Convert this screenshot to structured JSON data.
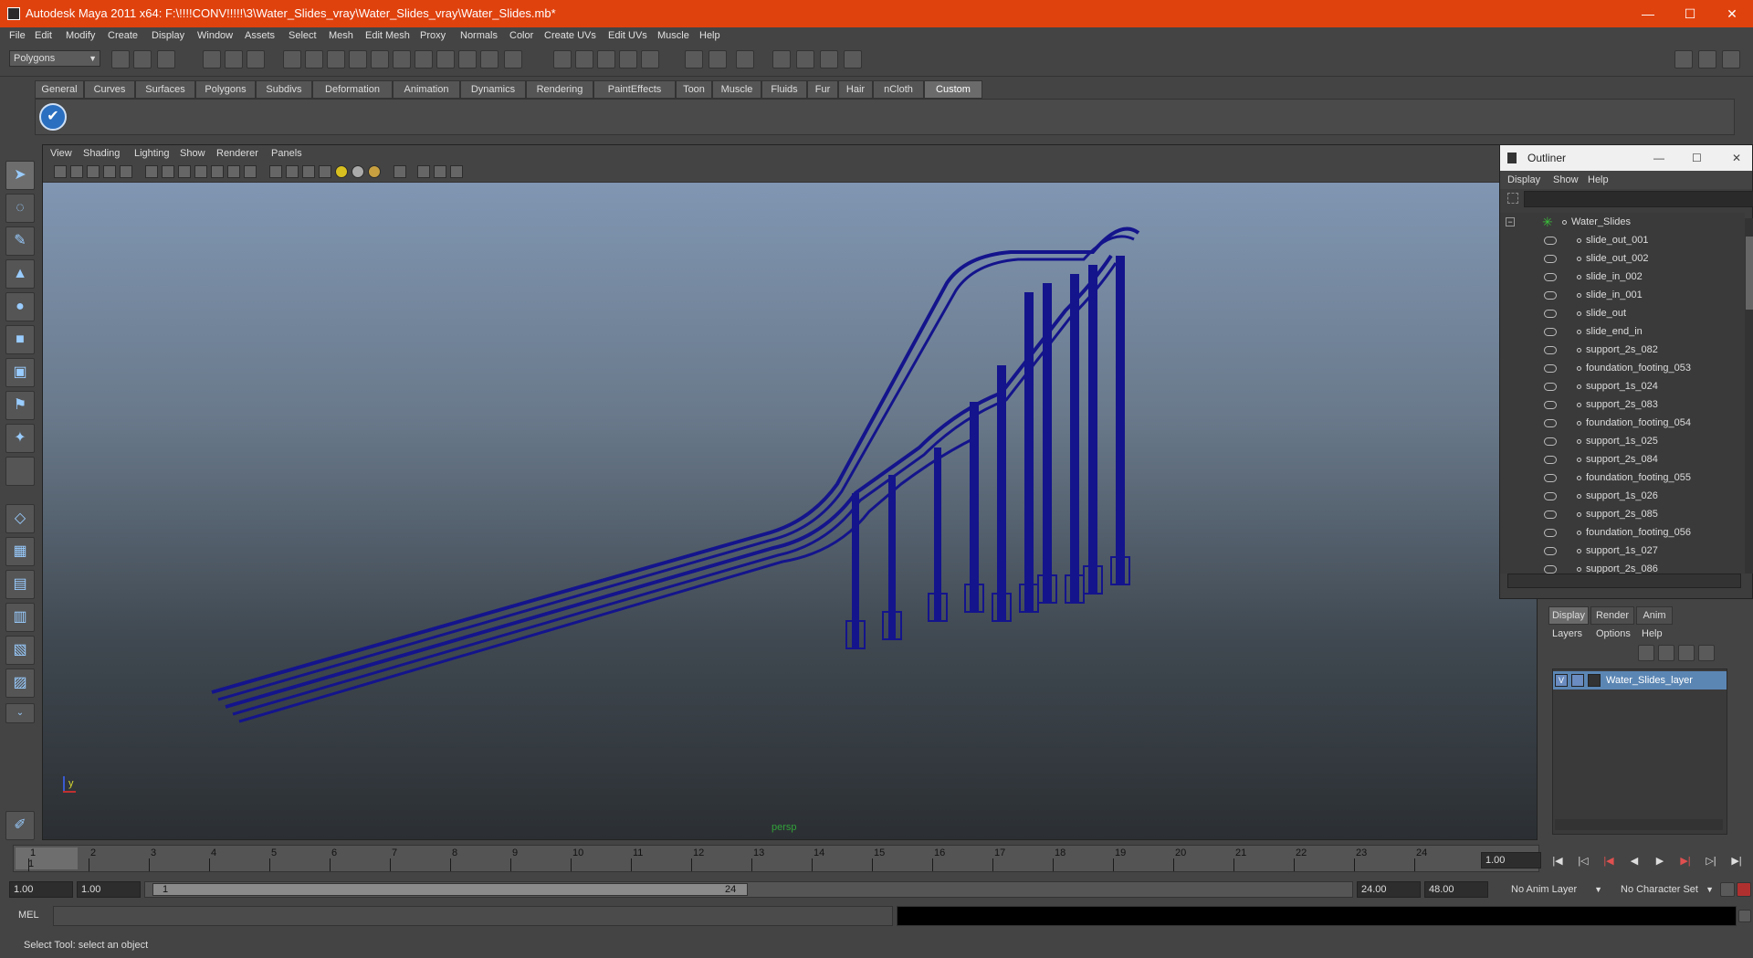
{
  "window": {
    "title": "Autodesk Maya 2011 x64: F:\\!!!!CONV!!!!!\\3\\Water_Slides_vray\\Water_Slides_vray\\Water_Slides.mb*",
    "minimize": "—",
    "maximize": "☐",
    "close": "✕"
  },
  "menubar": [
    "File",
    "Edit",
    "Modify",
    "Create",
    "Display",
    "Window",
    "Assets",
    "Select",
    "Mesh",
    "Edit Mesh",
    "Proxy",
    "Normals",
    "Color",
    "Create UVs",
    "Edit UVs",
    "Muscle",
    "Help"
  ],
  "toolbar": {
    "menu_set": "Polygons"
  },
  "shelf": {
    "tabs": [
      "General",
      "Curves",
      "Surfaces",
      "Polygons",
      "Subdivs",
      "Deformation",
      "Animation",
      "Dynamics",
      "Rendering",
      "PaintEffects",
      "Toon",
      "Muscle",
      "Fluids",
      "Fur",
      "Hair",
      "nCloth",
      "Custom"
    ],
    "active_tab": "Custom"
  },
  "viewport": {
    "menus": [
      "View",
      "Shading",
      "Lighting",
      "Show",
      "Renderer",
      "Panels"
    ],
    "camera": "persp",
    "axis_y": "y"
  },
  "outliner": {
    "title": "Outliner",
    "menus": [
      "Display",
      "Show",
      "Help"
    ],
    "root": "Water_Slides",
    "items": [
      "slide_out_001",
      "slide_out_002",
      "slide_in_002",
      "slide_in_001",
      "slide_out",
      "slide_end_in",
      "support_2s_082",
      "foundation_footing_053",
      "support_1s_024",
      "support_2s_083",
      "foundation_footing_054",
      "support_1s_025",
      "support_2s_084",
      "foundation_footing_055",
      "support_1s_026",
      "support_2s_085",
      "foundation_footing_056",
      "support_1s_027",
      "support_2s_086"
    ]
  },
  "layer_editor": {
    "tabs": [
      "Display",
      "Render",
      "Anim"
    ],
    "active_tab": "Display",
    "menus": [
      "Layers",
      "Options",
      "Help"
    ],
    "layer": {
      "visibility": "V",
      "name": "Water_Slides_layer"
    }
  },
  "timeline": {
    "ticks": [
      "1",
      "2",
      "3",
      "4",
      "5",
      "6",
      "7",
      "8",
      "9",
      "10",
      "11",
      "12",
      "13",
      "14",
      "15",
      "16",
      "17",
      "18",
      "19",
      "20",
      "21",
      "22",
      "23",
      "24"
    ],
    "current_marker": "1",
    "current_frame": "1.00"
  },
  "range": {
    "start": "1.00",
    "playback_start": "1.00",
    "handle_start": "1",
    "handle_end": "24",
    "playback_end": "24.00",
    "end": "48.00",
    "anim_layer": "No Anim Layer",
    "character_set": "No Character Set"
  },
  "command": {
    "label": "MEL",
    "help": "Select Tool: select an object"
  },
  "colors": {
    "title_bar": "#e0420e",
    "wireframe": "#14148c",
    "selection": "#5b86b4",
    "camera_label": "#32a03a"
  }
}
